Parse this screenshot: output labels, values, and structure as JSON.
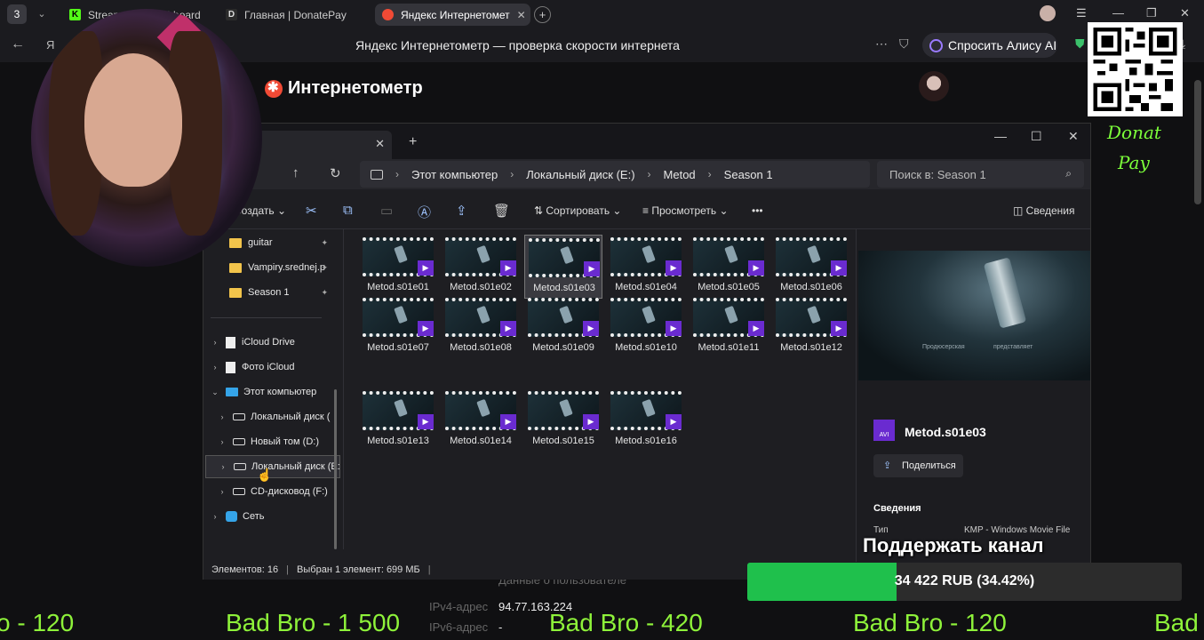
{
  "browser": {
    "tab_count": "3",
    "tabs": [
      {
        "label": "Stream Kick Dashboard",
        "favicon": "K",
        "color": "#53fc18"
      },
      {
        "label": "Главная | DonatePay",
        "favicon": "D",
        "color": "#2b2b2b"
      },
      {
        "label": "Яндекс Интернетомет",
        "favicon": "",
        "color": "#f04a35"
      }
    ],
    "page_title": "Яндекс Интернетометр — проверка скорости интернета",
    "alice_label": "Спросить Алису AI"
  },
  "webpage": {
    "logo": "Интернетометр",
    "user_info_heading": "Данные о пользователе",
    "ipv4_label": "IPv4-адрес",
    "ipv4_value": "94.77.163.224",
    "ipv6_label": "IPv6-адрес",
    "ipv6_value": "-"
  },
  "explorer": {
    "breadcrumbs": [
      "Этот компьютер",
      "Локальный диск (E:)",
      "Metod",
      "Season 1"
    ],
    "search_placeholder": "Поиск в: Season 1",
    "toolbar": {
      "create": "Создать",
      "sort": "Сортировать",
      "view": "Просмотреть",
      "more": "•••",
      "details": "Сведения"
    },
    "quick_access": [
      {
        "label": "guitar"
      },
      {
        "label": "Vampiry.srednej.p"
      },
      {
        "label": "Season 1"
      }
    ],
    "tree": [
      {
        "label": "iCloud Drive"
      },
      {
        "label": "Фото iCloud"
      },
      {
        "label": "Этот компьютер"
      },
      {
        "label": "Локальный диск ("
      },
      {
        "label": "Новый том (D:)"
      },
      {
        "label": "Локальный диск (E:)"
      },
      {
        "label": "CD-дисковод (F:)"
      },
      {
        "label": "Сеть"
      }
    ],
    "files": [
      "Metod.s01e01",
      "Metod.s01e02",
      "Metod.s01e03",
      "Metod.s01e04",
      "Metod.s01e05",
      "Metod.s01e06",
      "Metod.s01e07",
      "Metod.s01e08",
      "Metod.s01e09",
      "Metod.s01e10",
      "Metod.s01e11",
      "Metod.s01e12",
      "Metod.s01e13",
      "Metod.s01e14",
      "Metod.s01e15",
      "Metod.s01e16"
    ],
    "selected_file": "Metod.s01e03",
    "details": {
      "file_icon_label": "AVI",
      "name": "Metod.s01e03",
      "share": "Поделиться",
      "section": "Сведения",
      "type_key": "Тип",
      "type_value": "KMP - Windows Movie File",
      "preview_text_1": "Продюсерская",
      "preview_text_2": "представляет"
    },
    "status": {
      "count": "Элементов: 16",
      "selection": "Выбран 1 элемент: 699 МБ"
    }
  },
  "overlay": {
    "brand_line1": "Donat",
    "brand_line2": "Pay",
    "support_label": "Поддержать канал",
    "goal_text": "34 422 RUB (34.42%)",
    "goal_fraction": 0.3442,
    "ticker": [
      "o - 120",
      "Bad Bro - 1 500",
      "Bad Bro - 420",
      "Bad Bro - 120",
      "Bad"
    ]
  }
}
